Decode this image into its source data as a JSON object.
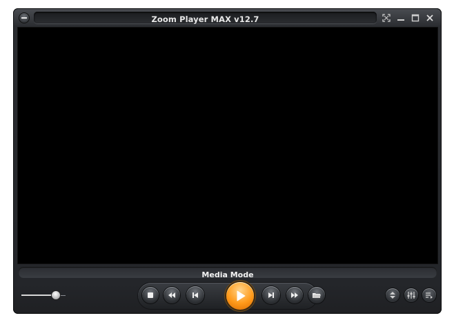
{
  "window": {
    "title": "Zoom Player MAX v12.7"
  },
  "titlebar": {
    "system_menu_icon": "minus-icon",
    "buttons": [
      {
        "name": "fullscreen",
        "icon": "fullscreen-arrows-icon"
      },
      {
        "name": "minimize",
        "icon": "minimize-icon"
      },
      {
        "name": "maximize",
        "icon": "maximize-icon"
      },
      {
        "name": "close",
        "icon": "close-icon"
      }
    ]
  },
  "status": {
    "mode_label": "Media Mode"
  },
  "volume": {
    "level": 0.75
  },
  "controls": [
    {
      "name": "stop",
      "icon": "stop-icon"
    },
    {
      "name": "rewind",
      "icon": "rewind-icon"
    },
    {
      "name": "previous",
      "icon": "skip-previous-icon"
    },
    {
      "name": "play",
      "icon": "play-icon"
    },
    {
      "name": "next",
      "icon": "skip-next-icon"
    },
    {
      "name": "fast-forward",
      "icon": "fast-forward-icon"
    },
    {
      "name": "open",
      "icon": "folder-icon"
    }
  ],
  "utilities": [
    {
      "name": "navigator",
      "icon": "up-down-arrows-icon"
    },
    {
      "name": "equalizer",
      "icon": "sliders-icon"
    },
    {
      "name": "playlist",
      "icon": "playlist-icon"
    }
  ],
  "colors": {
    "frame": "#2a2c30",
    "video_background": "#000000",
    "play_button": "#ff9a1a",
    "title_text": "#e8e8e8"
  }
}
